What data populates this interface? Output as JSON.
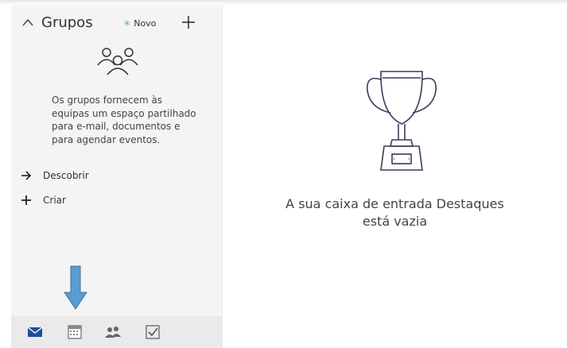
{
  "groups": {
    "title": "Grupos",
    "new_badge": "Novo",
    "description_lines": [
      "Os grupos fornecem às",
      "equipas um espaço partilhado",
      "para e-mail, documentos e",
      "para agendar eventos."
    ],
    "links": [
      {
        "label": "Descobrir",
        "icon": "arrow-right-icon"
      },
      {
        "label": "Criar",
        "icon": "plus-icon"
      }
    ]
  },
  "bottom_nav": [
    {
      "name": "mail",
      "icon": "mail-icon"
    },
    {
      "name": "calendar",
      "icon": "calendar-icon"
    },
    {
      "name": "people",
      "icon": "people-icon"
    },
    {
      "name": "tasks",
      "icon": "tasks-icon"
    }
  ],
  "main": {
    "empty_line_1": "A sua caixa de entrada Destaques",
    "empty_line_2": "está vazia"
  },
  "colors": {
    "accent": "#1f4e9c",
    "new_star": "#5cb85c",
    "indicator_arrow": "#5b9bd5",
    "sidebar_bg": "#f4f4f4"
  }
}
